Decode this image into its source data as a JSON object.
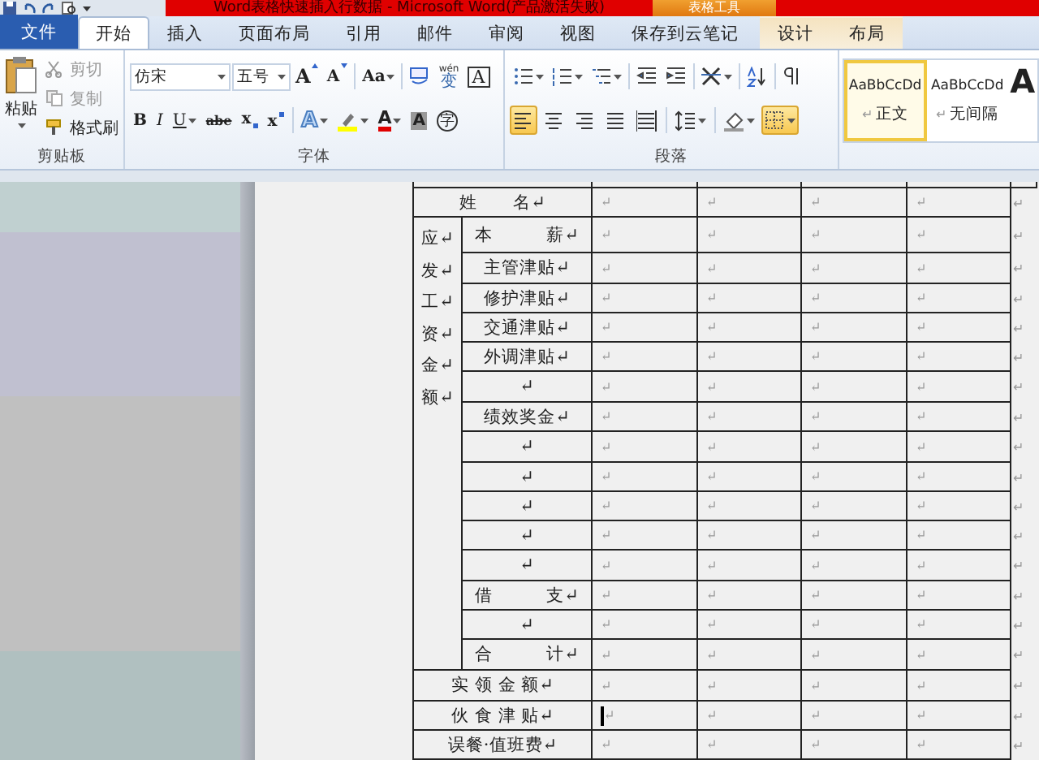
{
  "title_bar": {
    "title": "Word表格快速插入行数据 - Microsoft Word(产品激活失败)",
    "context_header": "表格工具"
  },
  "tabs": [
    {
      "label": "文件",
      "kind": "file",
      "selected": false
    },
    {
      "label": "开始",
      "kind": "normal",
      "selected": true
    },
    {
      "label": "插入",
      "kind": "normal",
      "selected": false
    },
    {
      "label": "页面布局",
      "kind": "normal",
      "selected": false
    },
    {
      "label": "引用",
      "kind": "normal",
      "selected": false
    },
    {
      "label": "邮件",
      "kind": "normal",
      "selected": false
    },
    {
      "label": "审阅",
      "kind": "normal",
      "selected": false
    },
    {
      "label": "视图",
      "kind": "normal",
      "selected": false
    },
    {
      "label": "保存到云笔记",
      "kind": "normal",
      "selected": false
    },
    {
      "label": "设计",
      "kind": "contextual",
      "selected": false
    },
    {
      "label": "布局",
      "kind": "contextual",
      "selected": false
    }
  ],
  "clipboard": {
    "paste": "粘贴",
    "items": [
      {
        "kind": "cut",
        "label": "剪切",
        "disabled": true
      },
      {
        "kind": "copy",
        "label": "复制",
        "disabled": true
      },
      {
        "kind": "painter",
        "label": "格式刷",
        "disabled": false
      }
    ],
    "group_label": "剪贴板"
  },
  "font": {
    "font_name": "仿宋",
    "font_size": "五号",
    "group_label": "字体",
    "row1": [
      {
        "kind": "grow",
        "glyph": "A"
      },
      {
        "kind": "shrink",
        "glyph": "A"
      },
      {
        "kind": "case",
        "glyph": "Aa"
      },
      {
        "kind": "clear"
      },
      {
        "kind": "phonetic",
        "glyph": "变",
        "pinyin": "wén"
      },
      {
        "kind": "boxed",
        "glyph": "A"
      }
    ],
    "row2": [
      {
        "kind": "bold",
        "glyph": "B"
      },
      {
        "kind": "italic",
        "glyph": "I"
      },
      {
        "kind": "underline",
        "glyph": "U"
      },
      {
        "kind": "strike",
        "glyph": "abe"
      },
      {
        "kind": "sub",
        "glyph": "x"
      },
      {
        "kind": "sup",
        "glyph": "x"
      },
      {
        "kind": "effect",
        "glyph": "A"
      },
      {
        "kind": "highlight"
      },
      {
        "kind": "color",
        "glyph": "A"
      },
      {
        "kind": "shade",
        "glyph": "A"
      },
      {
        "kind": "enclose",
        "glyph": "字"
      }
    ]
  },
  "paragraph": {
    "group_label": "段落",
    "row1": [
      {
        "kind": "bullets"
      },
      {
        "kind": "numbering"
      },
      {
        "kind": "multilevel"
      },
      {
        "kind": "outdent"
      },
      {
        "kind": "indent"
      },
      {
        "kind": "asian"
      },
      {
        "kind": "sort"
      },
      {
        "kind": "marks"
      }
    ],
    "row2": [
      {
        "kind": "left",
        "selected": true
      },
      {
        "kind": "center",
        "selected": false
      },
      {
        "kind": "right",
        "selected": false
      },
      {
        "kind": "justify",
        "selected": false
      },
      {
        "kind": "distribute",
        "selected": false
      },
      {
        "kind": "spacing",
        "selected": false
      },
      {
        "kind": "shading",
        "selected": false
      },
      {
        "kind": "borders",
        "selected": true
      }
    ]
  },
  "styles": [
    {
      "preview": "AaBbCcDd",
      "mark": "↵",
      "name": "正文",
      "selected": true
    },
    {
      "preview": "AaBbCcDd",
      "mark": "↵",
      "name": "无间隔",
      "selected": false
    },
    {
      "preview": "A",
      "selected": false
    }
  ],
  "table": {
    "side_label": [
      "应↵",
      "发↵",
      "工↵",
      "资↵",
      "金↵",
      "额↵"
    ],
    "rows": [
      {
        "kind": "full",
        "label": "姓　　名↵",
        "cells": [
          "↵",
          "↵",
          "↵",
          "↵"
        ],
        "end": "↵",
        "caret": false
      },
      {
        "kind": "sub",
        "label": "本　　　薪↵",
        "cells": [
          "↵",
          "↵",
          "↵",
          "↵"
        ],
        "end": "↵",
        "caret": false
      },
      {
        "kind": "sub",
        "label": "主管津贴↵",
        "cells": [
          "↵",
          "↵",
          "↵",
          "↵"
        ],
        "end": "↵",
        "caret": false
      },
      {
        "kind": "sub",
        "label": "修护津贴↵",
        "cells": [
          "↵",
          "↵",
          "↵",
          "↵"
        ],
        "end": "↵",
        "caret": false
      },
      {
        "kind": "sub",
        "label": "交通津贴↵",
        "cells": [
          "↵",
          "↵",
          "↵",
          "↵"
        ],
        "end": "↵",
        "caret": false
      },
      {
        "kind": "sub",
        "label": "外调津贴↵",
        "cells": [
          "↵",
          "↵",
          "↵",
          "↵"
        ],
        "end": "↵",
        "caret": false
      },
      {
        "kind": "sub",
        "label": "↵",
        "cells": [
          "↵",
          "↵",
          "↵",
          "↵"
        ],
        "end": "↵",
        "caret": false
      },
      {
        "kind": "sub",
        "label": "绩效奖金↵",
        "cells": [
          "↵",
          "↵",
          "↵",
          "↵"
        ],
        "end": "↵",
        "caret": false
      },
      {
        "kind": "sub",
        "label": "↵",
        "cells": [
          "↵",
          "↵",
          "↵",
          "↵"
        ],
        "end": "↵",
        "caret": false
      },
      {
        "kind": "sub",
        "label": "↵",
        "cells": [
          "↵",
          "↵",
          "↵",
          "↵"
        ],
        "end": "↵",
        "caret": false
      },
      {
        "kind": "sub",
        "label": "↵",
        "cells": [
          "↵",
          "↵",
          "↵",
          "↵"
        ],
        "end": "↵",
        "caret": false
      },
      {
        "kind": "sub",
        "label": "↵",
        "cells": [
          "↵",
          "↵",
          "↵",
          "↵"
        ],
        "end": "↵",
        "caret": false
      },
      {
        "kind": "sub",
        "label": "↵",
        "cells": [
          "↵",
          "↵",
          "↵",
          "↵"
        ],
        "end": "↵",
        "caret": false
      },
      {
        "kind": "sub",
        "label": "借　　　支↵",
        "cells": [
          "↵",
          "↵",
          "↵",
          "↵"
        ],
        "end": "↵",
        "caret": false
      },
      {
        "kind": "sub",
        "label": "↵",
        "cells": [
          "↵",
          "↵",
          "↵",
          "↵"
        ],
        "end": "↵",
        "caret": false
      },
      {
        "kind": "sub",
        "label": "合　　　计↵",
        "cells": [
          "↵",
          "↵",
          "↵",
          "↵"
        ],
        "end": "↵",
        "caret": false
      },
      {
        "kind": "full",
        "label": "实 领 金 额↵",
        "cells": [
          "↵",
          "↵",
          "↵",
          "↵"
        ],
        "end": "↵",
        "caret": false
      },
      {
        "kind": "full",
        "label": "伙 食 津 贴↵",
        "cells": [
          "↵",
          "↵",
          "↵",
          "↵"
        ],
        "end": "↵",
        "caret": true
      },
      {
        "kind": "full",
        "label": "误餐·值班费↵",
        "cells": [
          "↵",
          "↵",
          "↵",
          "↵"
        ],
        "end": "↵",
        "caret": false
      }
    ]
  }
}
